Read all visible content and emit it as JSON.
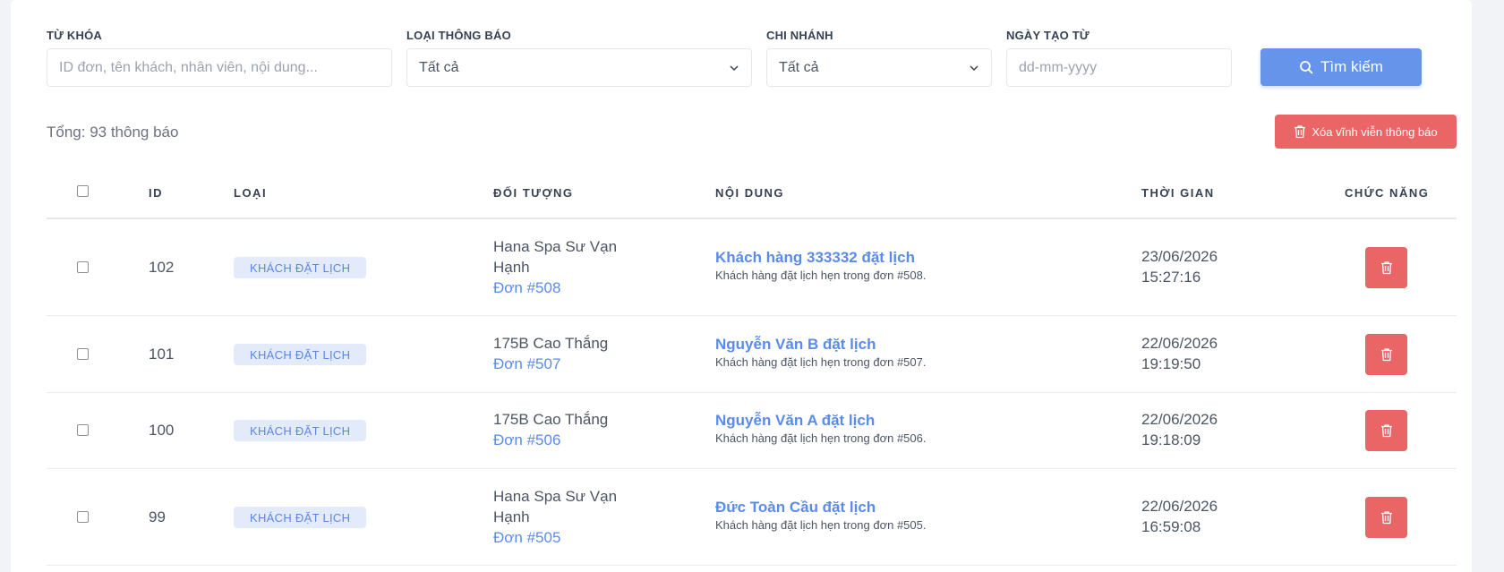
{
  "filters": {
    "keyword": {
      "label": "TỪ KHÓA",
      "placeholder": "ID đơn, tên khách, nhân viên, nội dung..."
    },
    "type": {
      "label": "LOẠI THÔNG BÁO",
      "value": "Tất cả"
    },
    "branch": {
      "label": "CHI NHÁNH",
      "value": "Tất cả"
    },
    "date_from": {
      "label": "NGÀY TẠO TỪ",
      "placeholder": "dd-mm-yyyy"
    },
    "search_label": "Tìm kiếm"
  },
  "summary": {
    "total": "Tổng: 93 thông báo"
  },
  "delete_all_label": "Xóa vĩnh viễn thông báo",
  "table": {
    "headers": {
      "id": "ID",
      "type": "LOẠI",
      "target": "ĐỐI TƯỢNG",
      "content": "NỘI DUNG",
      "time": "THỜI GIAN",
      "actions": "CHỨC NĂNG"
    },
    "rows": [
      {
        "id": "102",
        "type": "KHÁCH ĐẶT LỊCH",
        "branch_line1": "Hana Spa Sư Vạn",
        "branch_line2": "Hạnh",
        "order": "Đơn #508",
        "title": "Khách hàng 333332 đặt lịch",
        "desc": "Khách hàng đặt lịch hẹn trong đơn #508.",
        "date": "23/06/2026",
        "time": "15:27:16"
      },
      {
        "id": "101",
        "type": "KHÁCH ĐẶT LỊCH",
        "branch_line1": "175B Cao Thắng",
        "branch_line2": "",
        "order": "Đơn #507",
        "title": "Nguyễn Văn B đặt lịch",
        "desc": "Khách hàng đặt lịch hẹn trong đơn #507.",
        "date": "22/06/2026",
        "time": "19:19:50"
      },
      {
        "id": "100",
        "type": "KHÁCH ĐẶT LỊCH",
        "branch_line1": "175B Cao Thắng",
        "branch_line2": "",
        "order": "Đơn #506",
        "title": "Nguyễn Văn A đặt lịch",
        "desc": "Khách hàng đặt lịch hẹn trong đơn #506.",
        "date": "22/06/2026",
        "time": "19:18:09"
      },
      {
        "id": "99",
        "type": "KHÁCH ĐẶT LỊCH",
        "branch_line1": "Hana Spa Sư Vạn",
        "branch_line2": "Hạnh",
        "order": "Đơn #505",
        "title": "Đức Toàn Cầu đặt lịch",
        "desc": "Khách hàng đặt lịch hẹn trong đơn #505.",
        "date": "22/06/2026",
        "time": "16:59:08"
      }
    ]
  },
  "colors": {
    "primary": "#6694ea",
    "danger": "#ea6666",
    "badge_bg": "#e3eafa",
    "link": "#5b8be8"
  },
  "icons": {
    "search": "search-icon",
    "trash": "trash-icon",
    "chevron": "chevron-down-icon"
  }
}
